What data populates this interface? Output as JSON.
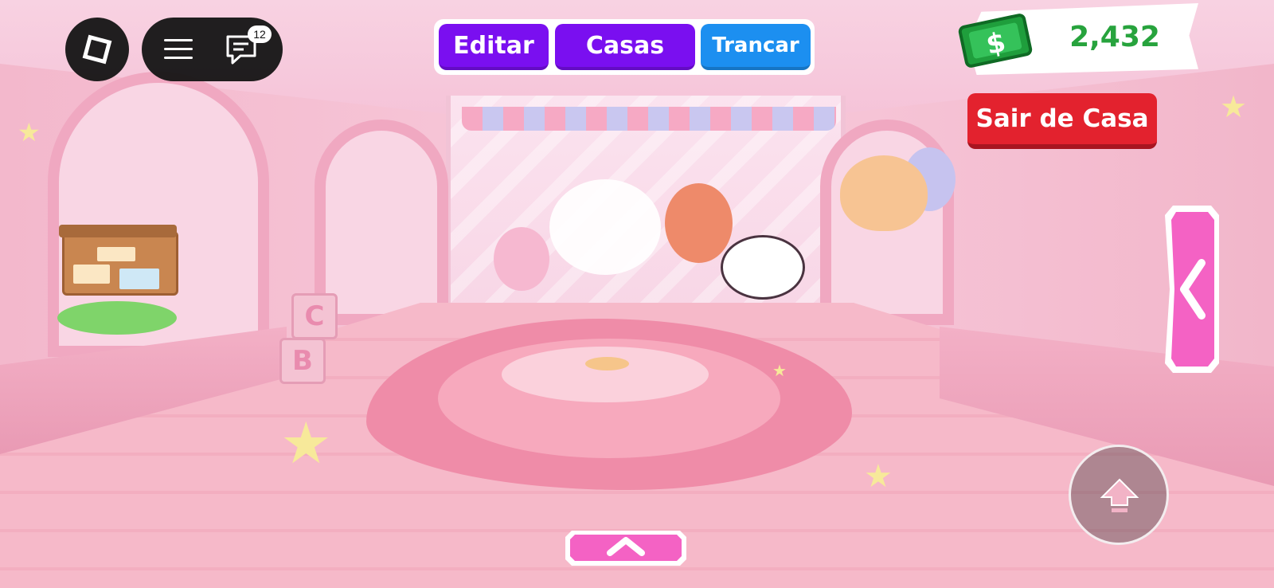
{
  "chat": {
    "unread_count": "12"
  },
  "house_tabs": {
    "edit": "Editar",
    "houses": "Casas",
    "lock": "Trancar"
  },
  "currency": {
    "balance": "2,432",
    "icon": "cash-icon",
    "color": "#27a33d"
  },
  "leave_button": {
    "label": "Sair de Casa",
    "color": "#e3222e"
  },
  "icons": {
    "menu": "roblox-logo-icon",
    "hamburger": "hamburger-icon",
    "chat": "chat-icon",
    "side_panel": "chevron-left-icon",
    "bottom_panel": "chevron-up-icon",
    "jump": "arrow-up-icon"
  },
  "colors": {
    "tab_purple": "#7a0ff0",
    "tab_blue": "#1c8ff0",
    "panel_pink": "#f462c4"
  }
}
